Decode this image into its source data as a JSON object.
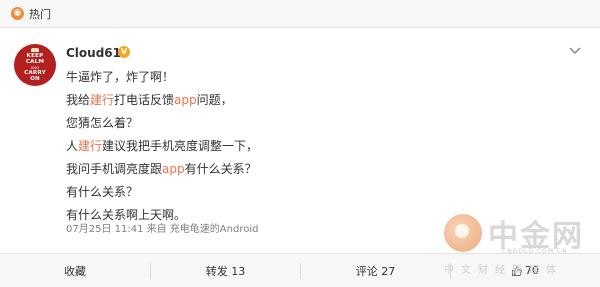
{
  "header": {
    "title": "热门"
  },
  "post": {
    "avatar_text": [
      "KEEP",
      "CALM",
      "AND",
      "CARRY",
      "ON"
    ],
    "username": "Cloud61",
    "verified_badge": "V",
    "lines": [
      [
        {
          "t": "牛逼炸了，炸了啊！"
        }
      ],
      [
        {
          "t": "我给"
        },
        {
          "t": "建行",
          "hl": true
        },
        {
          "t": "打电话反馈"
        },
        {
          "t": "app",
          "hl": true
        },
        {
          "t": "问题，"
        }
      ],
      [
        {
          "t": "您猜怎么着？"
        }
      ],
      [
        {
          "t": "人"
        },
        {
          "t": "建行",
          "hl": true
        },
        {
          "t": "建议我把手机亮度调整一下，"
        }
      ],
      [
        {
          "t": "我问手机调亮度跟"
        },
        {
          "t": "app",
          "hl": true
        },
        {
          "t": "有什么关系？"
        }
      ],
      [
        {
          "t": "有什么关系？"
        }
      ],
      [
        {
          "t": "有什么关系啊上天啊。"
        }
      ]
    ],
    "meta": "07月25日 11:41  来自 充电龟速的Android"
  },
  "actions": {
    "favorite": "收藏",
    "repost": "转发 13",
    "comment": "评论 27",
    "like": "70"
  },
  "watermark": {
    "name": "中金网",
    "url": "CNGOLD.COM.CN",
    "tagline": "中文财经新媒体"
  },
  "colors": {
    "highlight": "#eb7350",
    "badge": "#f5a623",
    "avatar": "#b3201f"
  }
}
